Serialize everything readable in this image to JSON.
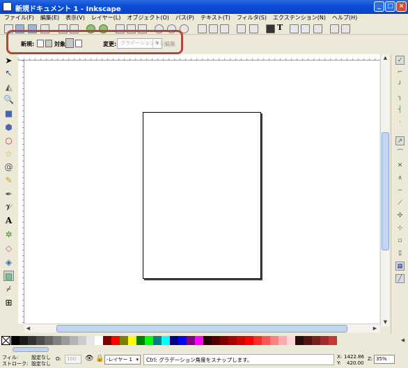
{
  "window": {
    "title": "新規ドキュメント 1 - Inkscape",
    "buttons": {
      "minimize": "_",
      "maximize": "□",
      "close": "×"
    }
  },
  "menu": [
    "ファイル(F)",
    "編集(E)",
    "表示(V)",
    "レイヤー(L)",
    "オブジェクト(O)",
    "パス(P)",
    "テキスト(T)",
    "フィルタ(S)",
    "エクステンション(N)",
    "ヘルプ(H)"
  ],
  "tool_controls": {
    "new_label": "新規:",
    "on_label": "対象:",
    "change_label": "変更:",
    "gradient_select_value": "グラデーションなし",
    "edit_label": "編集"
  },
  "palette": {
    "colors": [
      "#000000",
      "#1a1a1a",
      "#333333",
      "#4d4d4d",
      "#666666",
      "#808080",
      "#999999",
      "#b3b3b3",
      "#cccccc",
      "#e6e6e6",
      "#ffffff",
      "#800000",
      "#ff0000",
      "#808000",
      "#ffff00",
      "#008000",
      "#00ff00",
      "#008080",
      "#00ffff",
      "#000080",
      "#0000ff",
      "#800080",
      "#ff00ff",
      "#2b0000",
      "#550000",
      "#800000",
      "#aa0000",
      "#d40000",
      "#ff0000",
      "#ff2a2a",
      "#ff5555",
      "#ff8080",
      "#ffaaaa",
      "#ffd5d5",
      "#280b0b",
      "#501616",
      "#782121",
      "#a02c2c",
      "#c83737"
    ]
  },
  "status": {
    "fill_label": "フィル:",
    "fill_value": "設定なし",
    "stroke_label": "ストローク:",
    "stroke_value": "設定なし",
    "opacity_label": "O:",
    "opacity_value": "100",
    "layer": "-レイヤー 1",
    "message": "Ctrl: グラデーション角度をスナップします。",
    "x_label": "X:",
    "x_value": "1422.86",
    "y_label": "Y:",
    "y_value": "420.00",
    "zoom_label": "Z:",
    "zoom_value": "35%"
  }
}
